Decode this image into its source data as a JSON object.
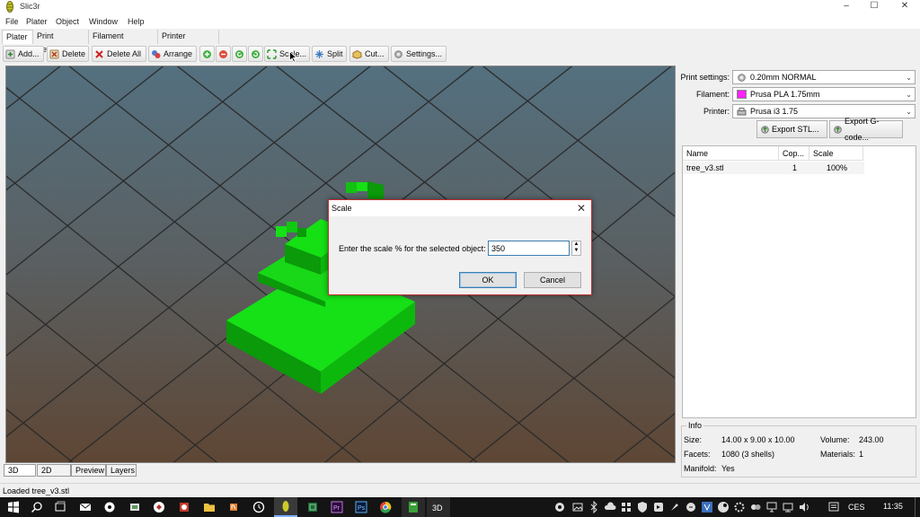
{
  "window": {
    "title": "Slic3r",
    "controls": [
      "–",
      "☐",
      "✕"
    ]
  },
  "menu": [
    "File",
    "Plater",
    "Object",
    "Window",
    "Help"
  ],
  "tabs": [
    "Plater",
    "Print Settings",
    "Filament Settings",
    "Printer Settings"
  ],
  "toolbar": {
    "add": "Add...",
    "delete": "Delete",
    "delete_all": "Delete All",
    "arrange": "Arrange",
    "scale": "Scale...",
    "split": "Split",
    "cut": "Cut...",
    "settings": "Settings..."
  },
  "view_tabs": [
    "3D",
    "2D",
    "Preview",
    "Layers"
  ],
  "status": "Loaded tree_v3.stl",
  "right_panel": {
    "print_label": "Print settings:",
    "print_value": "0.20mm NORMAL",
    "filament_label": "Filament:",
    "filament_value": "Prusa PLA 1.75mm",
    "filament_color": "#ff22ff",
    "printer_label": "Printer:",
    "printer_value": "Prusa i3 1.75",
    "export_stl": "Export STL...",
    "export_gcode": "Export G-code..."
  },
  "object_list": {
    "headers": [
      "Name",
      "Cop...",
      "Scale"
    ],
    "rows": [
      {
        "name": "tree_v3.stl",
        "copies": "1",
        "scale": "100%"
      }
    ]
  },
  "info": {
    "title": "Info",
    "size_label": "Size:",
    "size_value": "14.00 x 9.00 x 10.00",
    "volume_label": "Volume:",
    "volume_value": "243.00",
    "facets_label": "Facets:",
    "facets_value": "1080 (3 shells)",
    "materials_label": "Materials:",
    "materials_value": "1",
    "manifold_label": "Manifold:",
    "manifold_value": "Yes"
  },
  "dialog": {
    "title": "Scale",
    "prompt": "Enter the scale % for the selected object:",
    "value": "350",
    "ok": "OK",
    "cancel": "Cancel"
  },
  "taskbar": {
    "lang": "CES",
    "time": "11:35"
  },
  "colors": {
    "model_green": "#10d010",
    "accent_blue": "#3c7fb1",
    "dialog_border": "#c03030"
  }
}
